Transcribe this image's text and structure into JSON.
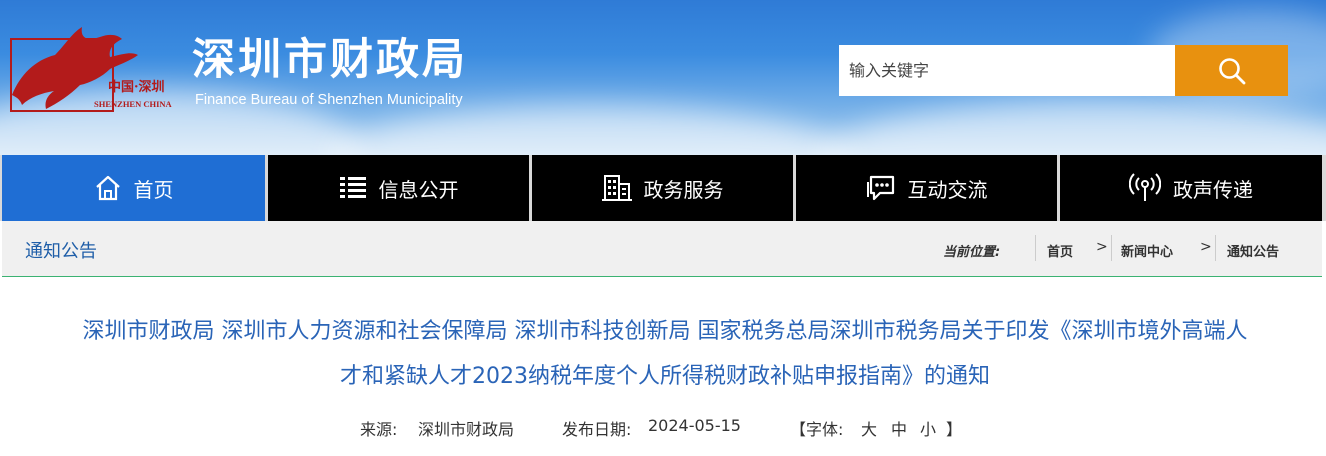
{
  "header": {
    "logo_text_cn": "中国·深圳",
    "logo_text_en": "SHENZHEN CHINA",
    "title": "深圳市财政局",
    "subtitle": "Finance Bureau of Shenzhen Municipality",
    "search": {
      "placeholder": "输入关键字",
      "button_icon": "search-icon"
    }
  },
  "nav": [
    {
      "label": "首页",
      "icon": "home-icon",
      "active": true
    },
    {
      "label": "信息公开",
      "icon": "list-icon",
      "active": false
    },
    {
      "label": "政务服务",
      "icon": "building-icon",
      "active": false
    },
    {
      "label": "互动交流",
      "icon": "chat-icon",
      "active": false
    },
    {
      "label": "政声传递",
      "icon": "broadcast-icon",
      "active": false
    }
  ],
  "breadcrumb": {
    "section_title": "通知公告",
    "current_label": "当前位置:",
    "items": [
      "首页",
      "新闻中心",
      "通知公告"
    ],
    "separator": ">"
  },
  "article": {
    "title_line1": "深圳市财政局 深圳市人力资源和社会保障局 深圳市科技创新局 国家税务总局深圳市税务局关于印发《深圳市境外高端人",
    "title_line2": "才和紧缺人才2023纳税年度个人所得税财政补贴申报指南》的通知",
    "source_label": "来源:",
    "source_value": "深圳市财政局",
    "date_label": "发布日期:",
    "date_value": "2024-05-15",
    "font_bracket_open": "【字体:",
    "font_large": "大",
    "font_medium": "中",
    "font_small": "小",
    "font_bracket_close": "】"
  },
  "colors": {
    "accent_blue": "#1f6ed4",
    "nav_black": "#000000",
    "search_orange": "#e8910f",
    "title_blue": "#2a64b7",
    "divider_green": "#3bb272"
  }
}
